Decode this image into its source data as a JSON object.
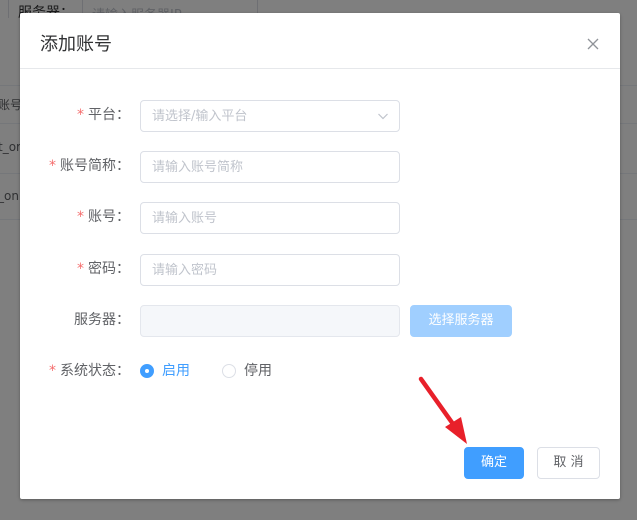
{
  "background": {
    "search_label": "服务器：",
    "search_placeholder": "请输入服务器IP",
    "table_header_fragment": "账号",
    "row_fragments": [
      "t_or",
      "_on"
    ]
  },
  "dialog": {
    "title": "添加账号",
    "close_icon": "close-icon",
    "fields": {
      "platform": {
        "label": "平台：",
        "required": true,
        "placeholder": "请选择/输入平台"
      },
      "short_name": {
        "label": "账号简称：",
        "required": true,
        "placeholder": "请输入账号简称"
      },
      "account": {
        "label": "账号：",
        "required": true,
        "placeholder": "请输入账号"
      },
      "password": {
        "label": "密码：",
        "required": true,
        "placeholder": "请输入密码"
      },
      "server": {
        "label": "服务器：",
        "required": false,
        "value": "",
        "choose_button": "选择服务器"
      },
      "status": {
        "label": "系统状态：",
        "required": true,
        "options": [
          "启用",
          "停用"
        ],
        "selected": "启用"
      }
    },
    "required_mark": "*",
    "footer": {
      "confirm_label": "确定",
      "cancel_label": "取 消"
    }
  },
  "colors": {
    "primary": "#409eff",
    "primary_light": "#a0cfff",
    "required": "#f56c6c",
    "annotation_arrow": "#e8202a"
  }
}
